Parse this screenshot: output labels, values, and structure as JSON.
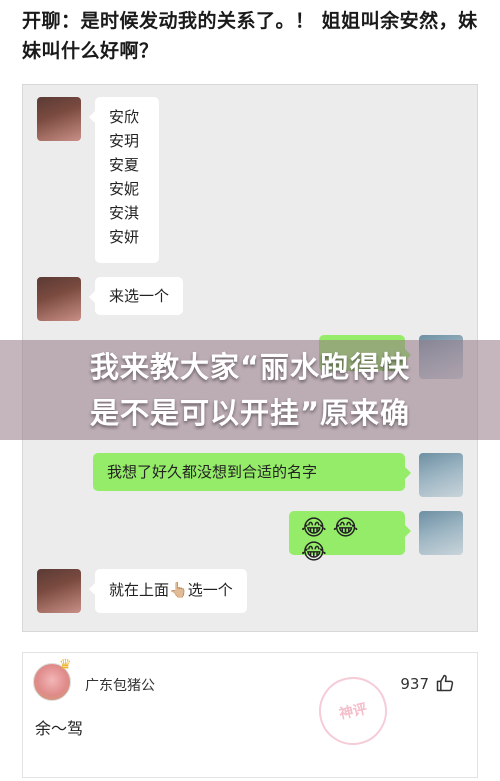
{
  "post": {
    "title": "开聊：是时候发动我的关系了。！ 姐姐叫余安然，妹妹叫什么好啊？"
  },
  "chat": {
    "names": [
      "安欣",
      "安玥",
      "安夏",
      "安妮",
      "安淇",
      "安妍"
    ],
    "msg_choose": "来选一个",
    "msg_thought": "我想了好久都没想到合适的名字",
    "msg_emojis": "😂😂😂",
    "msg_above_prefix": "就在上面",
    "msg_above_hand": "👆🏼",
    "msg_above_suffix": "选一个",
    "hidden_partial": "点"
  },
  "overlay": {
    "line1": "我来教大家“丽水跑得快",
    "line2": "是不是可以开挂”原来确"
  },
  "comment": {
    "username": "广东包猪公",
    "likes": "937",
    "text": "余～驾",
    "stamp": "神评"
  },
  "colors": {
    "chat_bg": "#ececec",
    "bubble_green": "#95ec69",
    "bubble_white": "#ffffff",
    "overlay_band": "#96788780"
  }
}
